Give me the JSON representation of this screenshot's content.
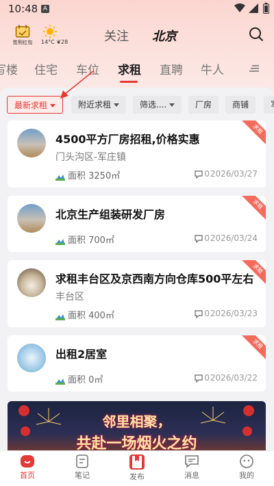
{
  "status": {
    "time": "10:48",
    "notif": "A"
  },
  "header": {
    "signin_label": "签到红包",
    "weather_temp": "14°C",
    "weather_aqi": "28",
    "tab_follow": "关注",
    "tab_city": "北京"
  },
  "categories": [
    "写楼",
    "住宅",
    "车位",
    "求租",
    "直聘",
    "牛人"
  ],
  "filters": [
    "最新求租",
    "附近求租",
    "筛选....",
    "厂房",
    "商铺",
    "写"
  ],
  "listings": [
    {
      "title": "4500平方厂房招租,价格实惠",
      "location": "门头沟区-军庄镇",
      "area": "面积 3250㎡",
      "comments": "0",
      "date": "2026/03/27",
      "tag": "求租"
    },
    {
      "title": "北京生产组装研发厂房",
      "location": "",
      "area": "面积 700㎡",
      "comments": "0",
      "date": "2026/03/24",
      "tag": "求租"
    },
    {
      "title": "求租丰台区及京西南方向仓库500平左右",
      "location": "丰台区",
      "area": "面积 400㎡",
      "comments": "0",
      "date": "2026/03/23",
      "tag": "求租"
    },
    {
      "title": "出租2居室",
      "location": "",
      "area": "面积 0㎡",
      "comments": "0",
      "date": "2026/03/22",
      "tag": "求租"
    }
  ],
  "banner": {
    "line1": "邻里相聚，",
    "line2": "共赴一场烟火之约"
  },
  "nav": [
    "首页",
    "笔记",
    "发布",
    "消息",
    "我的"
  ],
  "colors": {
    "accent": "#e53935",
    "ribbon": "#f26b5b"
  }
}
